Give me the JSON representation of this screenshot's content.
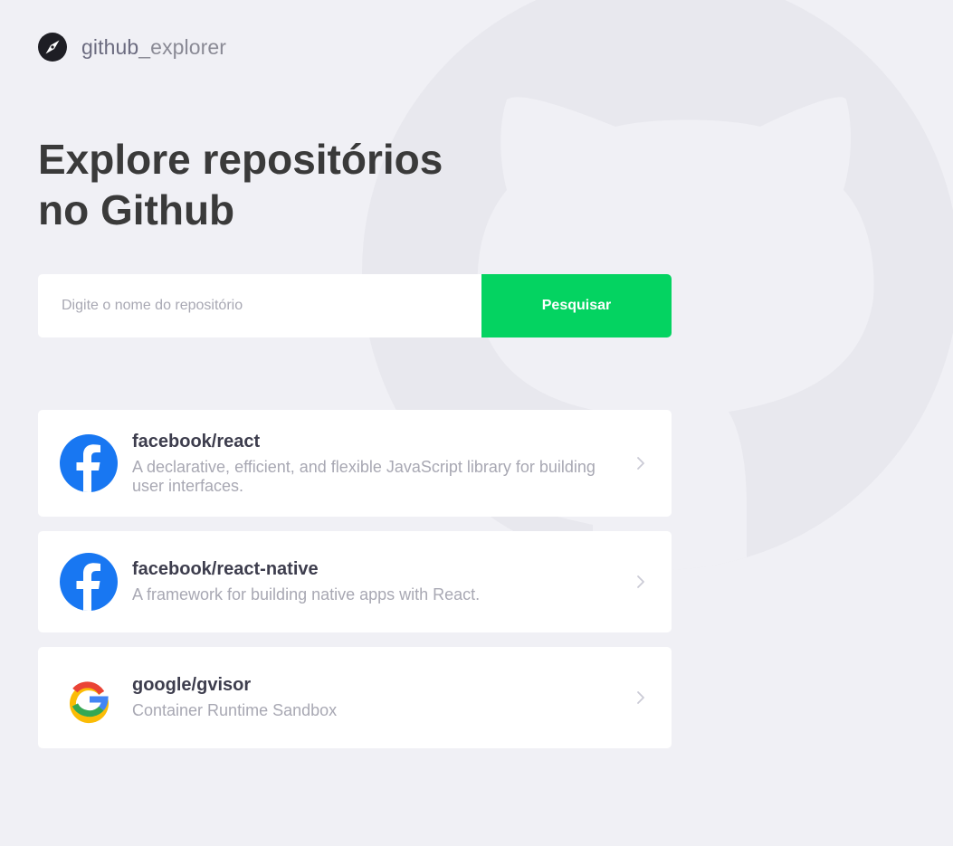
{
  "header": {
    "logo_icon": "compass-icon",
    "logo_name": "github",
    "logo_suffix": "_explorer"
  },
  "title": {
    "line1": "Explore repositórios",
    "line2": "no Github"
  },
  "search": {
    "placeholder": "Digite o nome do repositório",
    "value": "",
    "button_label": "Pesquisar"
  },
  "repositories": [
    {
      "name": "facebook/react",
      "description": "A declarative, efficient, and flexible JavaScript library for building user interfaces.",
      "avatar": "facebook-logo-icon"
    },
    {
      "name": "facebook/react-native",
      "description": "A framework for building native apps with React.",
      "avatar": "facebook-logo-icon"
    },
    {
      "name": "google/gvisor",
      "description": "Container Runtime Sandbox",
      "avatar": "google-logo-icon"
    }
  ],
  "colors": {
    "background": "#f0f0f5",
    "accent": "#04d361",
    "title": "#3a3a3a",
    "muted": "#a8a8b3",
    "facebook": "#1877f2"
  }
}
